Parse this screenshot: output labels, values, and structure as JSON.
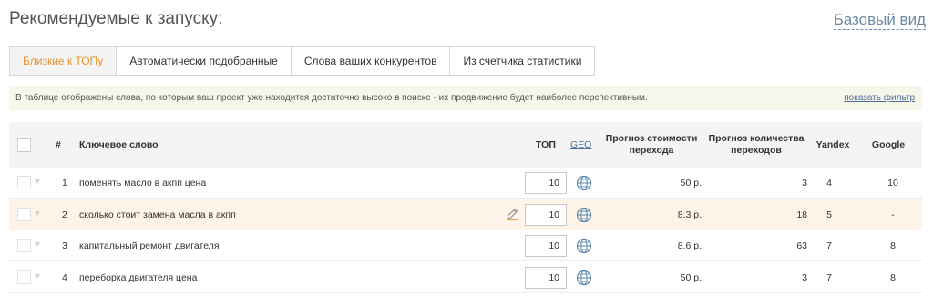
{
  "header": {
    "title": "Рекомендуемые к запуску:",
    "view_link": "Базовый вид"
  },
  "tabs": [
    {
      "label": "Близкие к ТОПу",
      "active": true
    },
    {
      "label": "Автоматически подобранные",
      "active": false
    },
    {
      "label": "Слова ваших конкурентов",
      "active": false
    },
    {
      "label": "Из счетчика статистики",
      "active": false
    }
  ],
  "info": {
    "text": "В таблице отображены слова, по которым ваш проект уже находится достаточно высоко в поиске - их продвижение будет наиболее перспективным.",
    "filter_link": "показать фильтр"
  },
  "table": {
    "columns": {
      "num": "#",
      "keyword": "Ключевое слово",
      "top": "ТОП",
      "geo": "GEO",
      "cost": "Прогноз стоимости перехода",
      "clicks": "Прогноз количества переходов",
      "yandex": "Yandex",
      "google": "Google"
    },
    "rows": [
      {
        "num": "1",
        "keyword": "поменять масло в акпп цена",
        "top": "10",
        "cost": "50 р.",
        "clicks": "3",
        "yandex": "4",
        "google": "10"
      },
      {
        "num": "2",
        "keyword": "сколько стоит замена масла в акпп",
        "top": "10",
        "cost": "8.3 р.",
        "clicks": "18",
        "yandex": "5",
        "google": "-"
      },
      {
        "num": "3",
        "keyword": "капитальный ремонт двигателя",
        "top": "10",
        "cost": "8.6 р.",
        "clicks": "63",
        "yandex": "7",
        "google": "8"
      },
      {
        "num": "4",
        "keyword": "переборка двигателя цена",
        "top": "10",
        "cost": "50 р.",
        "clicks": "3",
        "yandex": "7",
        "google": "8"
      }
    ]
  },
  "colors": {
    "active_tab_text": "#e8912b",
    "info_bg": "#f7f6ea",
    "highlight_row": "#fdf3e7",
    "link": "#4a6f9a"
  },
  "icons": {
    "globe": "globe-icon",
    "pencil": "pencil-icon",
    "row_arrow": "chevron-down-icon"
  }
}
